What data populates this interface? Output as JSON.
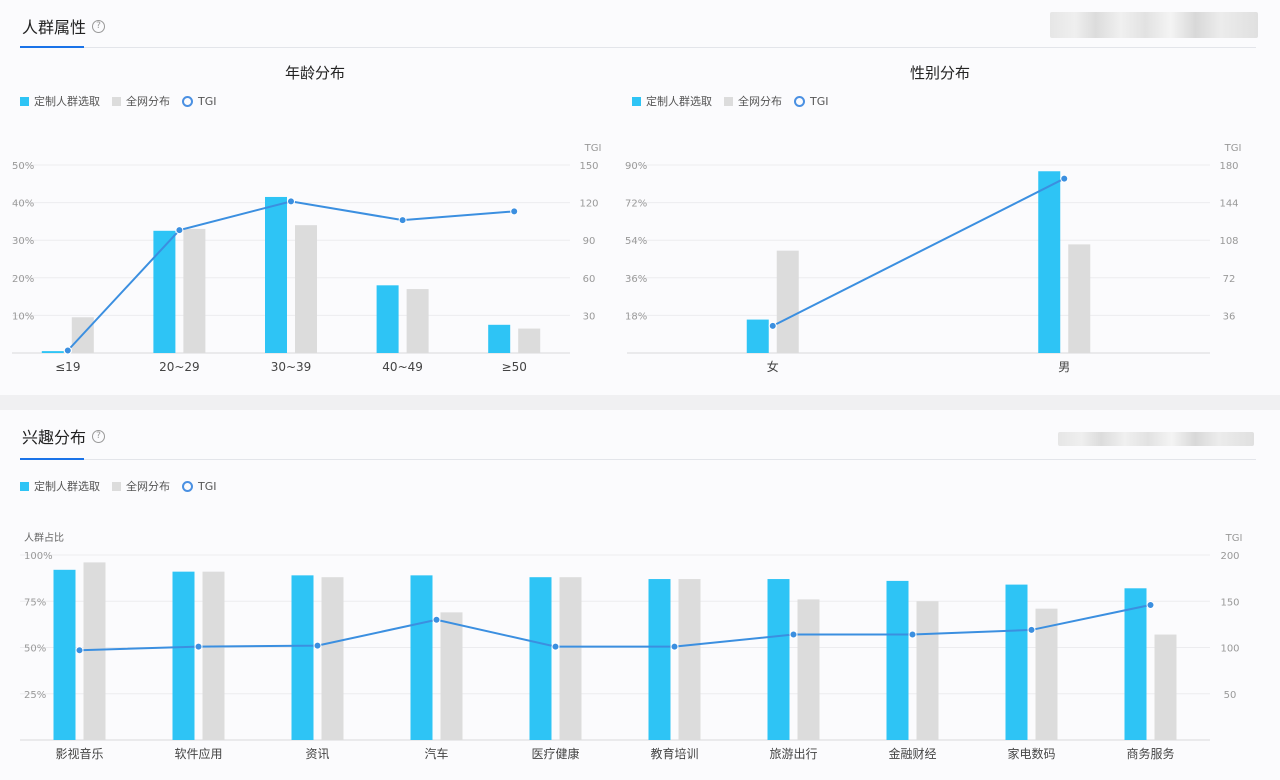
{
  "sections": {
    "attributes": {
      "title": "人群属性"
    },
    "interests": {
      "title": "兴趣分布"
    }
  },
  "legend": {
    "selected": "定制人群选取",
    "overall": "全网分布",
    "tgi": "TGI"
  },
  "colors": {
    "selected": "#2ec4f5",
    "overall": "#dcdcdc",
    "tgi_line": "#3b8fe0"
  },
  "icons": {
    "help": "help-circle-icon"
  },
  "chart_data": [
    {
      "id": "age",
      "type": "bar",
      "title": "年龄分布",
      "categories": [
        "≤19",
        "20~29",
        "30~39",
        "40~49",
        "≥50"
      ],
      "series": [
        {
          "name": "定制人群选取",
          "values": [
            0.5,
            32.5,
            41.5,
            18,
            7.5
          ]
        },
        {
          "name": "全网分布",
          "values": [
            9.5,
            33,
            34,
            17,
            6.5
          ]
        }
      ],
      "tgi": [
        2,
        98,
        121,
        106,
        113
      ],
      "y_left_ticks": [
        "10%",
        "20%",
        "30%",
        "40%",
        "50%"
      ],
      "y_right_ticks": [
        "30",
        "60",
        "90",
        "120",
        "150"
      ],
      "y_right_label": "TGI",
      "ylim_left": [
        0,
        50
      ],
      "ylim_right": [
        0,
        150
      ]
    },
    {
      "id": "gender",
      "type": "bar",
      "title": "性别分布",
      "categories": [
        "女",
        "男"
      ],
      "series": [
        {
          "name": "定制人群选取",
          "values": [
            16,
            87
          ]
        },
        {
          "name": "全网分布",
          "values": [
            49,
            52
          ]
        }
      ],
      "tgi": [
        26,
        167
      ],
      "y_left_ticks": [
        "18%",
        "36%",
        "54%",
        "72%",
        "90%"
      ],
      "y_right_ticks": [
        "36",
        "72",
        "108",
        "144",
        "180"
      ],
      "y_right_label": "TGI",
      "ylim_left": [
        0,
        90
      ],
      "ylim_right": [
        0,
        180
      ]
    },
    {
      "id": "interest",
      "type": "bar",
      "title": "",
      "categories": [
        "影视音乐",
        "软件应用",
        "资讯",
        "汽车",
        "医疗健康",
        "教育培训",
        "旅游出行",
        "金融财经",
        "家电数码",
        "商务服务"
      ],
      "series": [
        {
          "name": "定制人群选取",
          "values": [
            92,
            91,
            89,
            89,
            88,
            87,
            87,
            86,
            84,
            82
          ]
        },
        {
          "name": "全网分布",
          "values": [
            96,
            91,
            88,
            69,
            88,
            87,
            76,
            75,
            71,
            57
          ]
        }
      ],
      "tgi": [
        97,
        101,
        102,
        130,
        101,
        101,
        114,
        114,
        119,
        146
      ],
      "y_left_label": "人群占比",
      "y_left_ticks": [
        "25%",
        "50%",
        "75%",
        "100%"
      ],
      "y_right_ticks": [
        "50",
        "100",
        "150",
        "200"
      ],
      "y_right_label": "TGI",
      "ylim_left": [
        0,
        100
      ],
      "ylim_right": [
        0,
        200
      ]
    }
  ]
}
